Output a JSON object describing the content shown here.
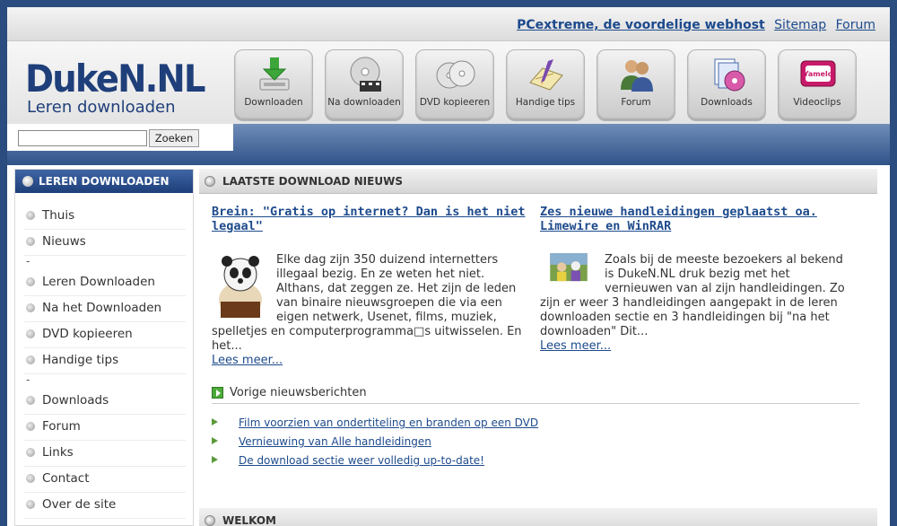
{
  "top": {
    "host_link": "PCextreme, de voordelige webhost",
    "sitemap_link": "Sitemap",
    "forum_link": "Forum"
  },
  "logo": {
    "title": "DukeN.NL",
    "subtitle": "Leren downloaden"
  },
  "nav": [
    {
      "label": "Downloaden",
      "icon": "download-arrow-icon"
    },
    {
      "label": "Na downloaden",
      "icon": "film-disc-icon"
    },
    {
      "label": "DVD kopieeren",
      "icon": "two-discs-icon"
    },
    {
      "label": "Handige tips",
      "icon": "notebook-pencil-icon"
    },
    {
      "label": "Forum",
      "icon": "people-icon"
    },
    {
      "label": "Downloads",
      "icon": "files-cd-icon"
    },
    {
      "label": "Videoclips",
      "icon": "yamelo-tv-icon"
    }
  ],
  "search": {
    "button_label": "Zoeken",
    "value": ""
  },
  "sidebar": {
    "heading": "LEREN DOWNLOADEN",
    "items": [
      {
        "label": "Thuis"
      },
      {
        "label": "Nieuws"
      },
      {
        "label": "Leren Downloaden"
      },
      {
        "label": "Na het Downloaden"
      },
      {
        "label": "DVD kopieeren"
      },
      {
        "label": "Handige tips"
      },
      {
        "label": "Downloads"
      },
      {
        "label": "Forum"
      },
      {
        "label": "Links"
      },
      {
        "label": "Contact"
      },
      {
        "label": "Over de site"
      }
    ],
    "separator": "-"
  },
  "news": {
    "heading": "LAATSTE DOWNLOAD NIEUWS",
    "articles": [
      {
        "title": "Brein: \"Gratis op internet? Dan is het niet legaal\"",
        "body": "Elke dag zijn 350 duizend internetters illegaal bezig. En ze weten het niet. Althans, dat zeggen ze. Het zijn de leden van binaire nieuwsgroepen die via een eigen netwerk, Usenet, films, muziek, spelletjes en computerprogramma□s uitwisselen. En het...",
        "more": "Lees meer..."
      },
      {
        "title": "Zes nieuwe handleidingen geplaatst oa. Limewire en WinRAR",
        "body": "Zoals bij de meeste bezoekers al bekend is DukeN.NL druk bezig met het vernieuwen van al zijn handleidingen. Zo zijn er weer 3 handleidingen aangepakt in de leren downloaden sectie en 3 handleidingen bij \"na het downloaden\"   Dit...",
        "more": "Lees meer..."
      }
    ],
    "previous_label": "Vorige nieuwsberichten",
    "previous_items": [
      {
        "label": "Film voorzien van ondertiteling en branden op een DVD"
      },
      {
        "label": "Vernieuwing van Alle handleidingen"
      },
      {
        "label": "De download sectie weer volledig up-to-date!"
      }
    ]
  },
  "welkom": {
    "heading": "WELKOM"
  },
  "colors": {
    "brand_blue": "#1f3f7a",
    "link_blue": "#1d4a8c",
    "nav_bar": "#2f5288"
  }
}
